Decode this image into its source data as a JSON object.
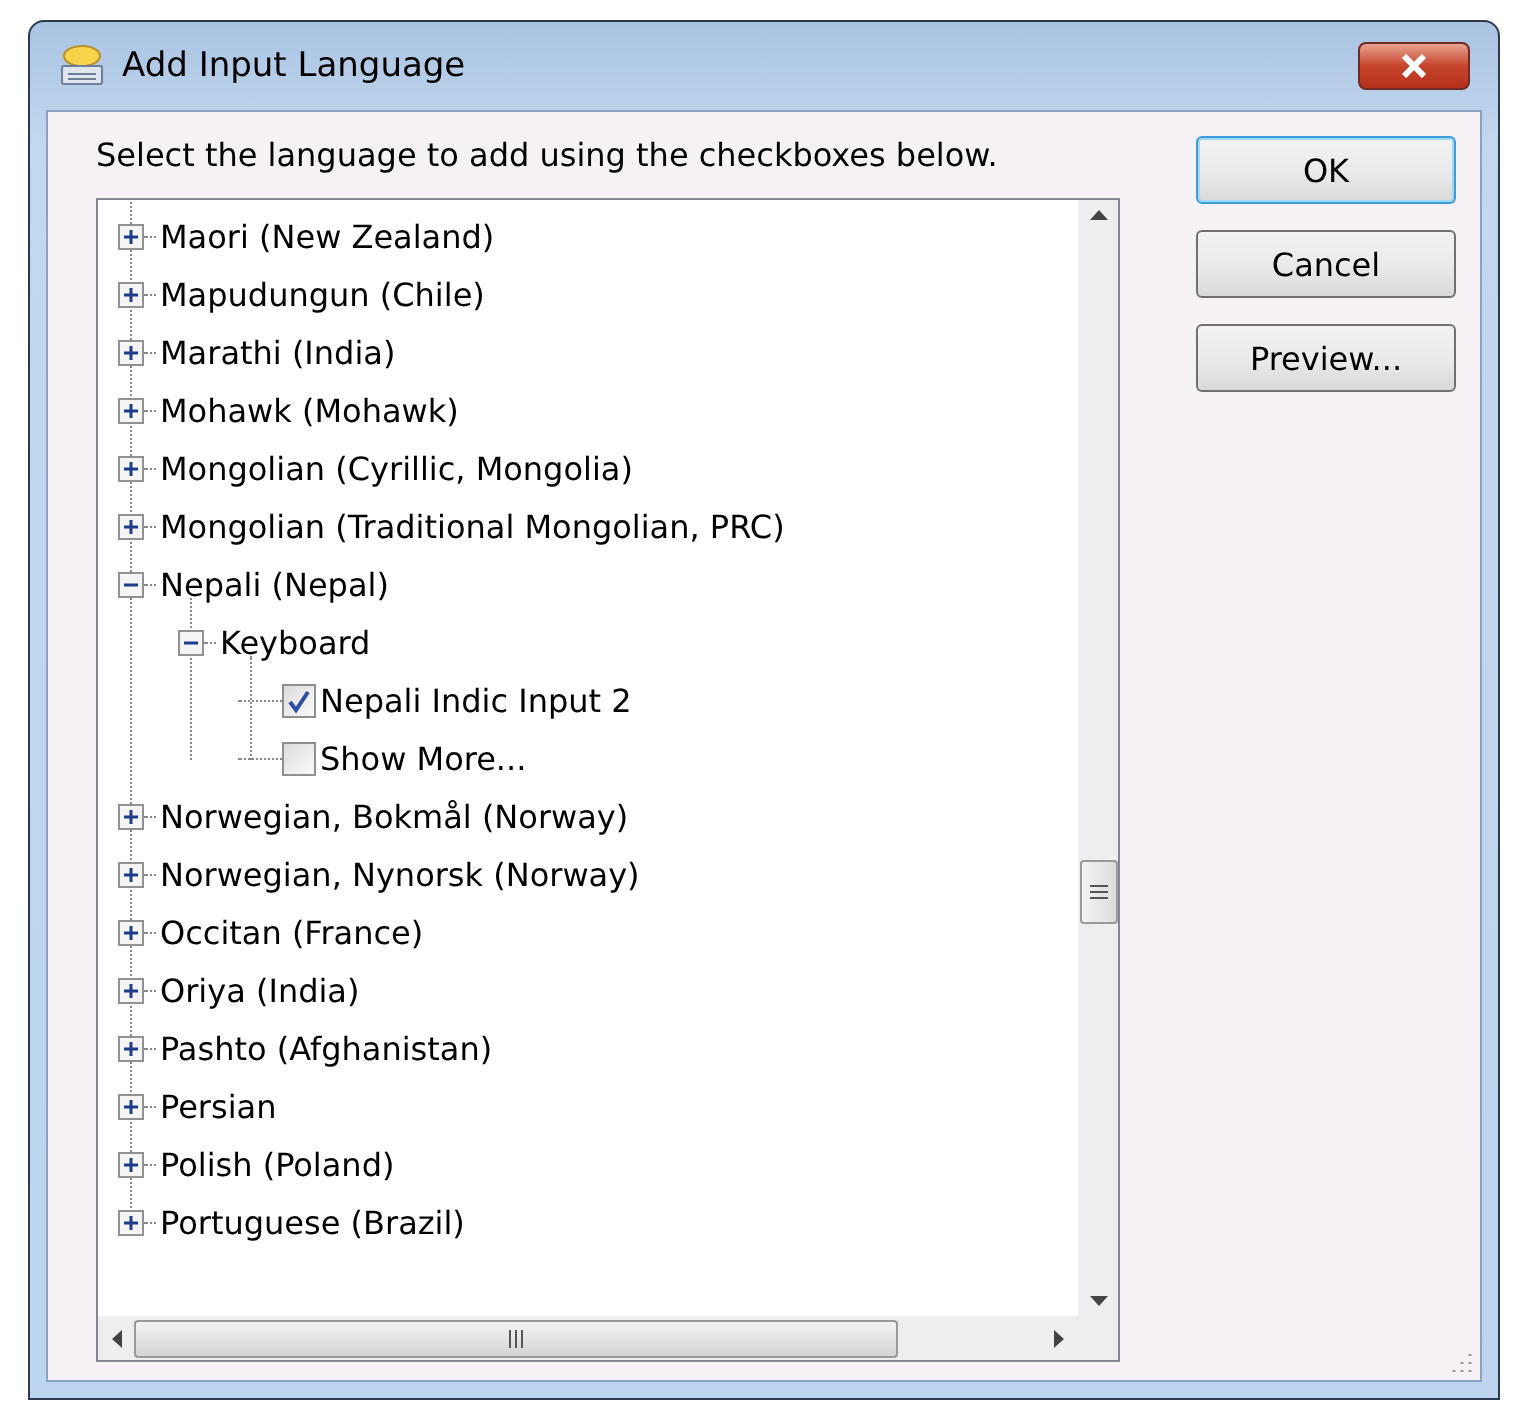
{
  "window": {
    "title": "Add Input Language"
  },
  "instruction": "Select the language to add using the checkboxes below.",
  "tree": {
    "items": [
      {
        "label": "Maori (New Zealand)",
        "expanded": false
      },
      {
        "label": "Mapudungun (Chile)",
        "expanded": false
      },
      {
        "label": "Marathi (India)",
        "expanded": false
      },
      {
        "label": "Mohawk (Mohawk)",
        "expanded": false
      },
      {
        "label": "Mongolian (Cyrillic, Mongolia)",
        "expanded": false
      },
      {
        "label": "Mongolian (Traditional Mongolian, PRC)",
        "expanded": false
      },
      {
        "label": "Nepali (Nepal)",
        "expanded": true,
        "children": [
          {
            "label": "Keyboard",
            "expanded": true,
            "children": [
              {
                "kind": "checkbox",
                "label": "Nepali Indic Input 2",
                "checked": true
              },
              {
                "kind": "checkbox",
                "label": "Show More...",
                "checked": false
              }
            ]
          }
        ]
      },
      {
        "label": "Norwegian, Bokmål (Norway)",
        "expanded": false
      },
      {
        "label": "Norwegian, Nynorsk (Norway)",
        "expanded": false
      },
      {
        "label": "Occitan (France)",
        "expanded": false
      },
      {
        "label": "Oriya (India)",
        "expanded": false
      },
      {
        "label": "Pashto (Afghanistan)",
        "expanded": false
      },
      {
        "label": "Persian",
        "expanded": false
      },
      {
        "label": "Polish (Poland)",
        "expanded": false
      },
      {
        "label": "Portuguese (Brazil)",
        "expanded": false
      }
    ]
  },
  "buttons": [
    {
      "label": "OK",
      "default": true
    },
    {
      "label": "Cancel",
      "default": false
    },
    {
      "label": "Preview...",
      "default": false
    }
  ]
}
